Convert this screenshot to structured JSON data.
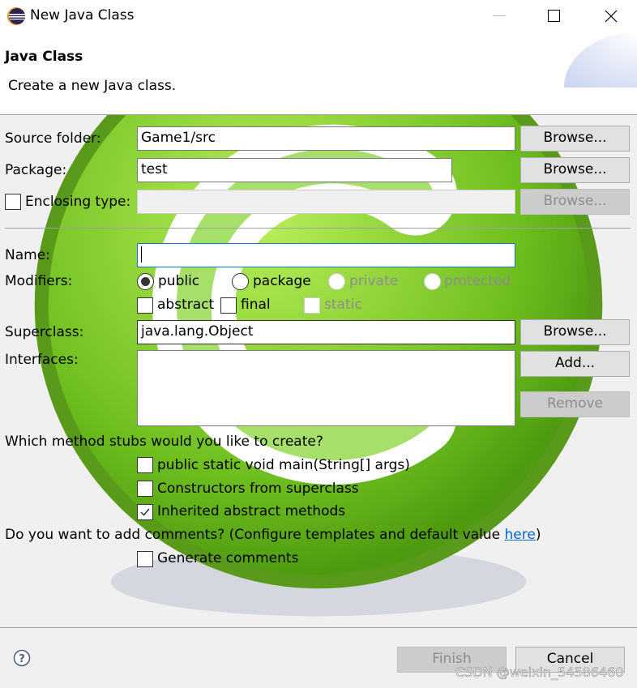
{
  "window": {
    "title": "New Java Class",
    "controls": {
      "minimize": "minimize",
      "maximize": "maximize",
      "close": "close"
    }
  },
  "header": {
    "title": "Java Class",
    "description": "Create a new Java class."
  },
  "form": {
    "source_folder": {
      "label": "Source folder:",
      "value": "Game1/src",
      "button": "Browse..."
    },
    "package": {
      "label": "Package:",
      "value": "test",
      "button": "Browse..."
    },
    "enclosing_type": {
      "label": "Enclosing type:",
      "checked": false,
      "value": "",
      "button": "Browse...",
      "enabled": false
    },
    "name": {
      "label": "Name:",
      "value": ""
    },
    "modifiers": {
      "label": "Modifiers:",
      "visibility": [
        {
          "label": "public",
          "selected": true,
          "enabled": true
        },
        {
          "label": "package",
          "selected": false,
          "enabled": true
        },
        {
          "label": "private",
          "selected": false,
          "enabled": false
        },
        {
          "label": "protected",
          "selected": false,
          "enabled": false
        }
      ],
      "flags": [
        {
          "label": "abstract",
          "checked": false,
          "enabled": true
        },
        {
          "label": "final",
          "checked": false,
          "enabled": true
        },
        {
          "label": "static",
          "checked": false,
          "enabled": false
        }
      ]
    },
    "superclass": {
      "label": "Superclass:",
      "value": "java.lang.Object",
      "button": "Browse..."
    },
    "interfaces": {
      "label": "Interfaces:",
      "items": [],
      "add_button": "Add...",
      "remove_button": "Remove"
    },
    "method_stubs": {
      "question": "Which method stubs would you like to create?",
      "options": [
        {
          "label": "public static void main(String[] args)",
          "checked": false
        },
        {
          "label": "Constructors from superclass",
          "checked": false
        },
        {
          "label": "Inherited abstract methods",
          "checked": true
        }
      ]
    },
    "comments": {
      "question_prefix": "Do you want to add comments? (Configure templates and default value ",
      "link_text": "here",
      "question_suffix": ")",
      "generate": {
        "label": "Generate comments",
        "checked": false
      }
    }
  },
  "footer": {
    "help": "help",
    "finish": "Finish",
    "cancel": "Cancel"
  },
  "watermark": "CSDN @weixin_54586460",
  "colors": {
    "focus_border": "#0078d7",
    "link": "#0066cc",
    "disabled_text": "#8d8d8d",
    "dialog_bg": "#f0f0f0"
  }
}
